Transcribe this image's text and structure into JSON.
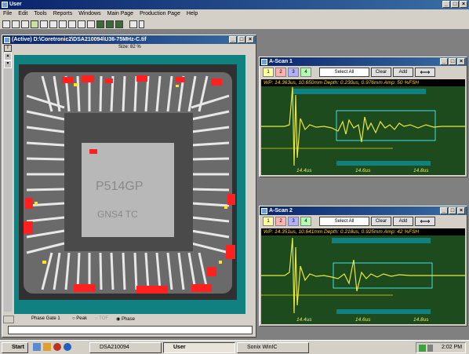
{
  "app": {
    "title": "User"
  },
  "menu": [
    "File",
    "Edit",
    "Tools",
    "Reports",
    "Windows",
    "Main Page",
    "Production Page",
    "Help"
  ],
  "cscan": {
    "title": "(Active) D:\\Coretronic2\\DSA210094\\U36-75MHz-C.tif",
    "size_label": "Size: 82 %",
    "gate_label": "Phase Gate 1",
    "radio_peak": "Peak",
    "radio_tof": "TOF",
    "radio_phase": "Phase",
    "chip_text": "P514GP",
    "chip_text2": "GNS4 TC"
  },
  "ascan1": {
    "title": "A-Scan 1",
    "gates": [
      "1",
      "2",
      "3",
      "4"
    ],
    "select_all": "Select All",
    "clear": "Clear",
    "add": "Add",
    "info": "WP: 14.363us, 10.650mm  Depth: 0.230us, 0.976mm  Amp:  50 %FSH",
    "ticks": [
      "14.4us",
      "14.6us",
      "14.8us"
    ]
  },
  "ascan2": {
    "title": "A-Scan 2",
    "gates": [
      "1",
      "2",
      "3",
      "4"
    ],
    "select_all": "Select All",
    "clear": "Clear",
    "add": "Add",
    "info": "WP: 14.351us, 10.641mm  Depth: 0.218us, 0.925mm  Amp:  42 %FSH",
    "ticks": [
      "14.4us",
      "14.6us",
      "14.8us"
    ]
  },
  "taskbar": {
    "start": "Start",
    "tasks": [
      "DSA210094",
      "User",
      "Sonix WinIC"
    ],
    "clock": "2:02 PM"
  },
  "colors": {
    "titlebar": "#0a246a",
    "scope_bg": "#1e4b1e",
    "trace": "#e8e840",
    "gate": "#108080"
  }
}
